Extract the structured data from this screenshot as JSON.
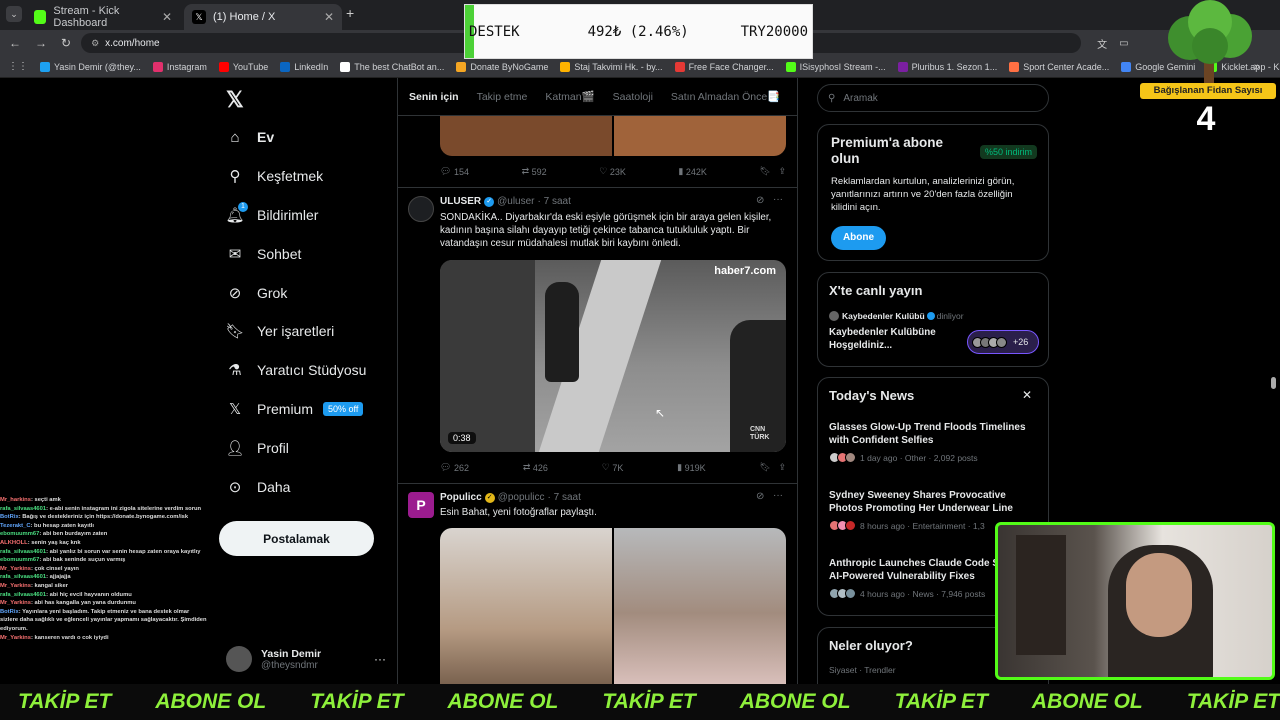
{
  "browser": {
    "tabs": [
      {
        "label": "Stream - Kick Dashboard",
        "active": false
      },
      {
        "label": "(1) Home / X",
        "active": true
      }
    ],
    "url": "x.com/home",
    "bookmarks": [
      "Yasin Demir (@they...",
      "Instagram",
      "YouTube",
      "LinkedIn",
      "The best ChatBot an...",
      "Donate ByNoGame",
      "Staj Takvimi Hk. - by...",
      "Free Face Changer...",
      "ISisyphosI Stream -...",
      "Pluribus 1. Sezon 1...",
      "Sport Center Acade...",
      "Google Gemini",
      "Kicklet.app - Kick C..."
    ]
  },
  "overlay": {
    "destek_label": "DESTEK",
    "destek_amount": "492₺ (2.46%)",
    "destek_goal": "TRY20000",
    "destek_progress": 0.0246,
    "fidan_label": "Bağışlanan Fidan Sayısı",
    "fidan_count": "4"
  },
  "sidebar": {
    "items": [
      {
        "label": "Ev",
        "icon": "home-icon"
      },
      {
        "label": "Keşfetmek",
        "icon": "search-icon"
      },
      {
        "label": "Bildirimler",
        "icon": "bell-icon"
      },
      {
        "label": "Sohbet",
        "icon": "mail-icon"
      },
      {
        "label": "Grok",
        "icon": "grok-icon"
      },
      {
        "label": "Yer işaretleri",
        "icon": "bookmark-icon"
      },
      {
        "label": "Yaratıcı Stüdyosu",
        "icon": "flask-icon"
      },
      {
        "label": "Premium",
        "icon": "x-logo-icon"
      },
      {
        "label": "Profil",
        "icon": "person-icon"
      },
      {
        "label": "Daha",
        "icon": "more-icon"
      }
    ],
    "premium_badge": "50% off",
    "post_button": "Postalamak",
    "user_name": "Yasin Demir",
    "user_handle": "@theysndmr",
    "notif_count": "1"
  },
  "feed": {
    "tabs": [
      "Senin için",
      "Takip etme",
      "Katman🎬",
      "Saatoloji",
      "Satın Almadan Önce📑"
    ],
    "top_stats": {
      "replies": "154",
      "reposts": "592",
      "likes": "23K",
      "views": "242K"
    },
    "tweet1": {
      "name": "ULUSER",
      "handle": "@uluser",
      "time": "· 7 saat",
      "text": "SONDAKİKA.. Diyarbakır'da eski eşiyle görüşmek için bir araya gelen kişiler, kadının başına silahı dayayıp tetiği çekince tabanca tutukluluk yaptı. Bir vatandaşın cesur müdahalesi mutlak biri kaybını önledi.",
      "video_duration": "0:38",
      "watermark": "haber7.com",
      "cnn": "CNN TÜRK",
      "stats": {
        "replies": "262",
        "reposts": "426",
        "likes": "7K",
        "views": "919K"
      }
    },
    "tweet2": {
      "name": "Populicc",
      "handle": "@populicc",
      "time": "· 7 saat",
      "text": "Esin Bahat, yeni fotoğraflar paylaştı.",
      "avatar_letter": "P"
    }
  },
  "right": {
    "search_placeholder": "Aramak",
    "premium": {
      "title": "Premium'a abone olun",
      "badge": "%50 indirim",
      "text": "Reklamlardan kurtulun, analizlerinizi görün, yanıtlarınızı artırın ve 20'den fazla özelliğin kilidini açın.",
      "button": "Abone"
    },
    "live": {
      "title": "X'te canlı yayın",
      "host": "Kaybedenler Kulübü",
      "status": "dinliyor",
      "text": "Kaybedenler Kulübüne Hoşgeldiniz...",
      "count": "+26"
    },
    "news": {
      "title": "Today's News",
      "items": [
        {
          "title": "Glasses Glow-Up Trend Floods Timelines with Confident Selfies",
          "meta": "1 day ago · Other · 2,092 posts"
        },
        {
          "title": "Sydney Sweeney Shares Provocative Photos Promoting Her Underwear Line",
          "meta": "8 hours ago · Entertainment · 1,3"
        },
        {
          "title": "Anthropic Launches Claude Code Se... for AI-Powered Vulnerability Fixes",
          "meta": "4 hours ago · News · 7,946 posts"
        }
      ]
    },
    "whats_happening": {
      "title": "Neler oluyor?",
      "sub": "Siyaset · Trendler"
    }
  },
  "chat": [
    {
      "user": "Mr_harkins",
      "cls": "r",
      "text": ": seçti amk"
    },
    {
      "user": "rafa_silvaas4601",
      "cls": "u",
      "text": ": e-abi senin instagram ini zigola sitelerine verdim sorun"
    },
    {
      "user": "BotRix",
      "cls": "b",
      "text": ": Bağış ve destekleriniz için https://donate.bynogame.com/isk"
    },
    {
      "user": "Tezerakt_C",
      "cls": "b",
      "text": ": bu hesap zaten kayıtlı"
    },
    {
      "user": "ebomuumm67",
      "cls": "u",
      "text": ": abi ben burdayım zaten"
    },
    {
      "user": "ALKHOLL",
      "cls": "r",
      "text": ": senin yaş kaç knk"
    },
    {
      "user": "rafa_silvaas4601",
      "cls": "u",
      "text": ": abi yanlız bi sorun var senin hesap zaten oraya kayıtlıy"
    },
    {
      "user": "ebomuumm67",
      "cls": "u",
      "text": ": abi bak seninde suçun varmış"
    },
    {
      "user": "Mr_Yarkins",
      "cls": "r",
      "text": ": çok cinsel yayın"
    },
    {
      "user": "rafa_silvaas4601",
      "cls": "u",
      "text": ": ajjajajja"
    },
    {
      "user": "Mr_Yarkins",
      "cls": "r",
      "text": ": kangal siker"
    },
    {
      "user": "rafa_silvaas4601",
      "cls": "u",
      "text": ": abi hiç evcil hayvanın oldumu"
    },
    {
      "user": "Mr_Yarkins",
      "cls": "r",
      "text": ": abi has kangalla yan yana durdunmu"
    },
    {
      "user": "BotRix",
      "cls": "b",
      "text": ": Yayınlara yeni başladım. Takip etmeniz ve bana destek olmar"
    },
    {
      "user": "",
      "cls": "u",
      "text": "sizlere daha sağlıklı ve eğlenceli yayınlar yapmamı sağlayacaktır. Şimdiden"
    },
    {
      "user": "",
      "cls": "u",
      "text": "ediyorum."
    },
    {
      "user": "Mr_Yarkins",
      "cls": "r",
      "text": ": kanseren vardı o cok iyiydi"
    }
  ],
  "ticker": [
    "TAKİP ET",
    "ABONE OL",
    "TAKİP ET",
    "ABONE OL",
    "TAKİP ET",
    "ABONE OL",
    "TAKİP ET",
    "ABONE OL",
    "TAKİP ET",
    "ABONE OL",
    "TAKİP ET",
    "ABONE OL"
  ]
}
